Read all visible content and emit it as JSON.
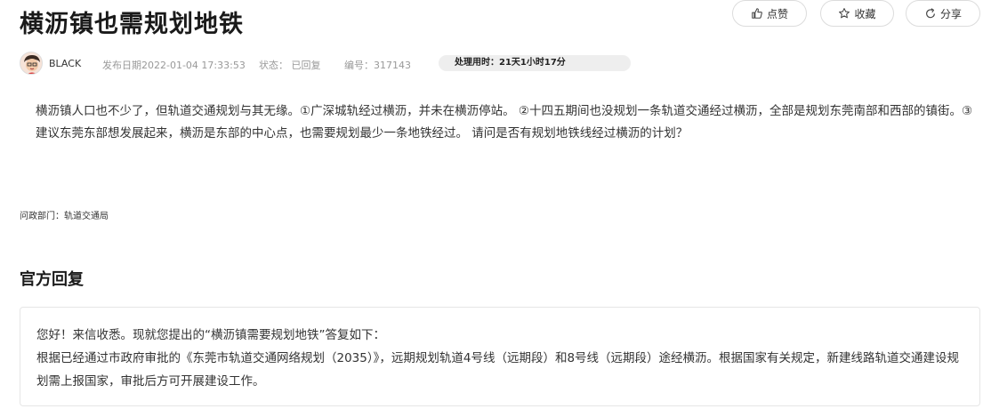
{
  "page": {
    "title": "横沥镇也需规划地铁"
  },
  "meta": {
    "user": "BLACK",
    "date": "发布日期2022-01-04 17:33:53",
    "status": "状态： 已回复",
    "number": "编号：317143",
    "processing_time": "处理用时：21天1小时17分"
  },
  "question": {
    "body": "横沥镇人口也不少了，但轨道交通规划与其无缘。①广深城轨经过横沥，并未在横沥停站。 ②十四五期间也没规划一条轨道交通经过横沥，全部是规划东莞南部和西部的镇街。③建议东莞东部想发展起来，横沥是东部的中心点，也需要规划最少一条地铁经过。 请问是否有规划地铁线经过横沥的计划？"
  },
  "department": "问政部门：轨道交通局",
  "actions": {
    "like": "点赞",
    "favorite": "收藏",
    "share": "分享"
  },
  "reply": {
    "heading": "官方回复",
    "line1": "您好！来信收悉。现就您提出的“横沥镇需要规划地铁”答复如下：",
    "line2": "根据已经通过市政府审批的《东莞市轨道交通网络规划（2035）》，远期规划轨道4号线（远期段）和8号线（远期段）途经横沥。根据国家有关规定，新建线路轨道交通建设规划需上报国家，审批后方可开展建设工作。"
  }
}
